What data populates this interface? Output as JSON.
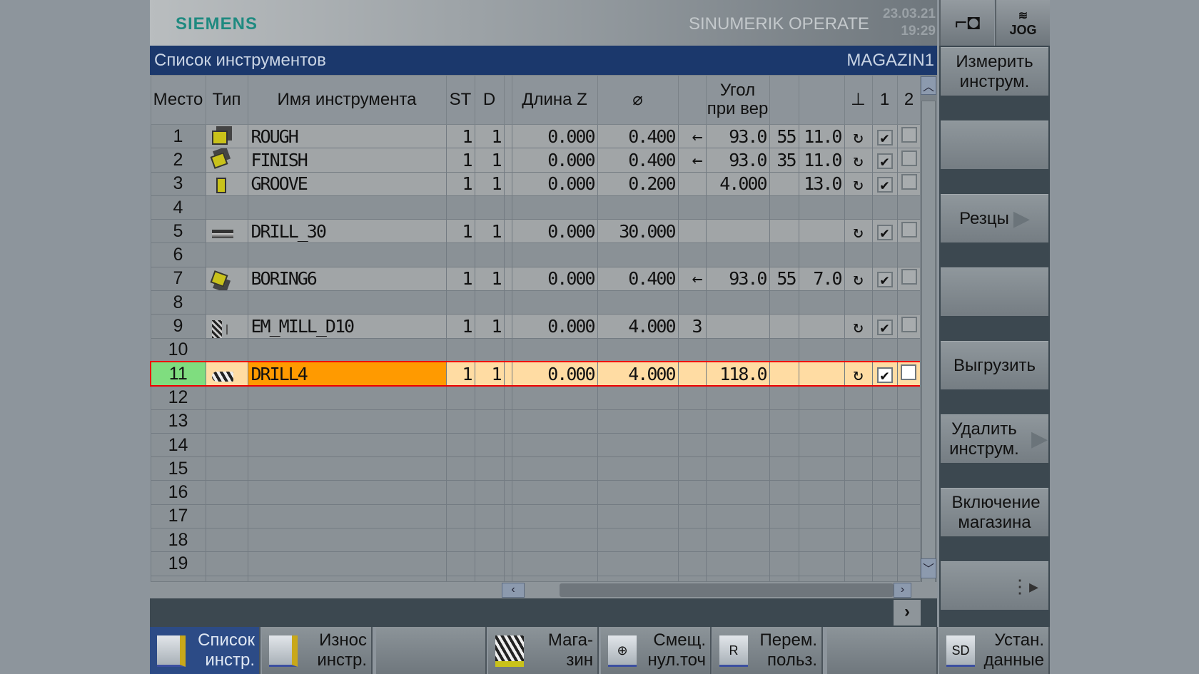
{
  "header": {
    "brand": "SIEMENS",
    "product": "SINUMERIK OPERATE",
    "date": "23.03.21",
    "time": "19:29",
    "mode": "JOG"
  },
  "title": {
    "left": "Список инструментов",
    "right": "MAGAZIN1"
  },
  "columns": [
    "Место",
    "Тип",
    "Имя инструмента",
    "ST",
    "D",
    "",
    "Длина Z",
    "⌀",
    "",
    "Угол при вер",
    "",
    "",
    "spindle",
    "1",
    "2"
  ],
  "rows": [
    {
      "place": "1",
      "type": "roughing-tool",
      "name": "ROUGH",
      "st": "1",
      "d": "1",
      "len": "0.000",
      "dia": "0.400",
      "dir": "←",
      "angle": "93.0",
      "c1": "55",
      "c2": "11.0",
      "cb1": true,
      "cb2": false
    },
    {
      "place": "2",
      "type": "finishing-tool",
      "name": "FINISH",
      "st": "1",
      "d": "1",
      "len": "0.000",
      "dia": "0.400",
      "dir": "←",
      "angle": "93.0",
      "c1": "35",
      "c2": "11.0",
      "cb1": true,
      "cb2": false
    },
    {
      "place": "3",
      "type": "grooving-tool",
      "name": "GROOVE",
      "st": "1",
      "d": "1",
      "len": "0.000",
      "dia": "0.200",
      "dir": "",
      "angle": "4.000",
      "c1": "",
      "c2": "13.0",
      "cb1": true,
      "cb2": false
    },
    {
      "place": "4"
    },
    {
      "place": "5",
      "type": "drill-tool",
      "name": "DRILL_30",
      "st": "1",
      "d": "1",
      "len": "0.000",
      "dia": "30.000",
      "dir": "",
      "angle": "",
      "c1": "",
      "c2": "",
      "cb1": true,
      "cb2": false
    },
    {
      "place": "6"
    },
    {
      "place": "7",
      "type": "boring-tool",
      "name": "BORING6",
      "st": "1",
      "d": "1",
      "len": "0.000",
      "dia": "0.400",
      "dir": "←",
      "angle": "93.0",
      "c1": "55",
      "c2": "7.0",
      "cb1": true,
      "cb2": false
    },
    {
      "place": "8"
    },
    {
      "place": "9",
      "type": "end-mill-tool",
      "name": "EM_MILL_D10",
      "st": "1",
      "d": "1",
      "len": "0.000",
      "dia": "4.000",
      "dir": "3",
      "angle": "",
      "c1": "",
      "c2": "",
      "cb1": true,
      "cb2": false
    },
    {
      "place": "10"
    },
    {
      "place": "11",
      "type": "twist-drill-tool",
      "name": "DRILL4",
      "st": "1",
      "d": "1",
      "len": "0.000",
      "dia": "4.000",
      "dir": "",
      "angle": "118.0",
      "c1": "",
      "c2": "",
      "cb1": true,
      "cb2": false,
      "selected": true
    },
    {
      "place": "12"
    },
    {
      "place": "13"
    },
    {
      "place": "14"
    },
    {
      "place": "15"
    },
    {
      "place": "16"
    },
    {
      "place": "17"
    },
    {
      "place": "18"
    },
    {
      "place": "19"
    }
  ],
  "softkeys_right": [
    "Измерить инструм.",
    "",
    "Резцы",
    "",
    "Выгрузить",
    "Удалить инструм.",
    "Включение магазина",
    ""
  ],
  "softkeys_bottom": [
    {
      "label": "Список инстр.",
      "icon": "tool-list-icon",
      "active": true
    },
    {
      "label": "Износ инстр.",
      "icon": "tool-wear-icon"
    },
    {
      "label": ""
    },
    {
      "label": "Мага- зин",
      "icon": "magazine-icon"
    },
    {
      "label": "Смещ. нул.точ",
      "icon": "work-offset-icon"
    },
    {
      "label": "Перем. польз.",
      "icon": "user-variables-icon",
      "glyph": "R"
    },
    {
      "label": ""
    },
    {
      "label": "Устан. данные",
      "icon": "setting-data-icon",
      "glyph": "SD"
    }
  ],
  "colors": {
    "title_bar": "#1b386c",
    "selected_place": "#7fdd7f",
    "selected_name": "#ff9a00",
    "selected_row": "#ffdca3",
    "selection_border": "#e00000"
  }
}
